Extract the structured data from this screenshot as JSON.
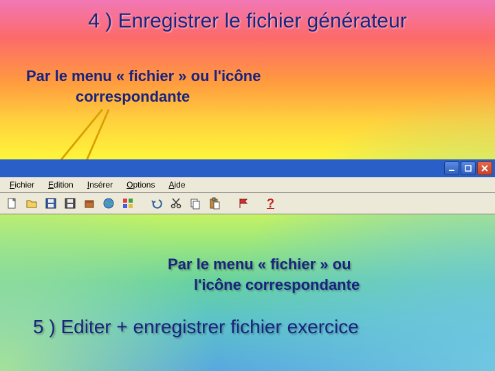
{
  "heading1": "4 )  Enregistrer le fichier générateur",
  "subtitle1_line1": "Par le menu «  fichier » ou l'icône",
  "subtitle1_line2": "correspondante",
  "menubar": {
    "file": "Fichier",
    "edit": "Edition",
    "insert": "Insérer",
    "options": "Options",
    "help": "Aide"
  },
  "toolbar": {
    "help_label": "?"
  },
  "subtitle2_line1": "Par le menu «  fichier » ou",
  "subtitle2_line2": "l'icône correspondante",
  "heading2": "5 ) Editer  + enregistrer fichier exercice"
}
